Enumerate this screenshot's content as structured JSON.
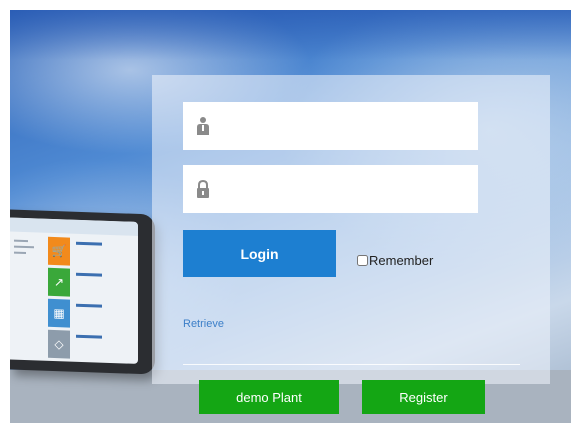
{
  "login": {
    "username_value": "",
    "password_value": "",
    "login_label": "Login",
    "remember_label": "Remember",
    "remember_checked": false,
    "retrieve_label": "Retrieve"
  },
  "footer": {
    "demo_label": "demo Plant",
    "register_label": "Register"
  },
  "icons": {
    "username": "user-icon",
    "password": "lock-icon"
  },
  "colors": {
    "login_button": "#1d7fd1",
    "green_buttons": "#14a614",
    "link": "#3c7fc8"
  }
}
